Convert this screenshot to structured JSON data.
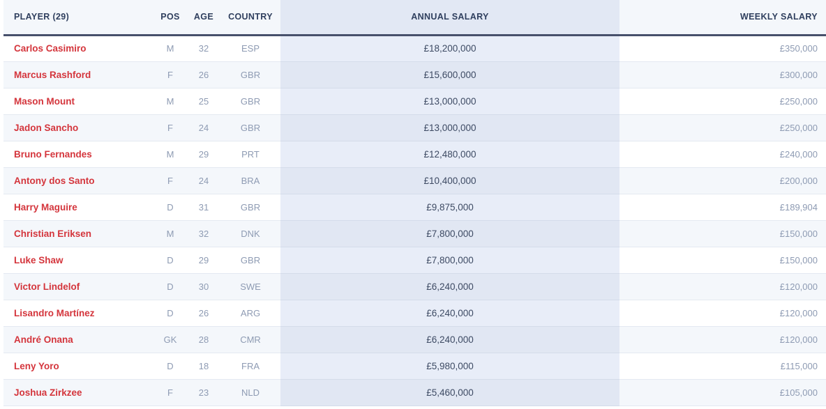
{
  "table": {
    "columns": [
      {
        "key": "player",
        "label": "PLAYER (29)",
        "align": "left"
      },
      {
        "key": "pos",
        "label": "POS",
        "align": "center"
      },
      {
        "key": "age",
        "label": "AGE",
        "align": "center"
      },
      {
        "key": "country",
        "label": "COUNTRY",
        "align": "center"
      },
      {
        "key": "annual",
        "label": "ANNUAL SALARY",
        "align": "center"
      },
      {
        "key": "weekly",
        "label": "WEEKLY SALARY",
        "align": "right"
      }
    ],
    "rows": [
      {
        "player": "Carlos Casimiro",
        "pos": "M",
        "age": "32",
        "country": "ESP",
        "annual": "£18,200,000",
        "weekly": "£350,000"
      },
      {
        "player": "Marcus Rashford",
        "pos": "F",
        "age": "26",
        "country": "GBR",
        "annual": "£15,600,000",
        "weekly": "£300,000"
      },
      {
        "player": "Mason Mount",
        "pos": "M",
        "age": "25",
        "country": "GBR",
        "annual": "£13,000,000",
        "weekly": "£250,000"
      },
      {
        "player": "Jadon Sancho",
        "pos": "F",
        "age": "24",
        "country": "GBR",
        "annual": "£13,000,000",
        "weekly": "£250,000"
      },
      {
        "player": "Bruno Fernandes",
        "pos": "M",
        "age": "29",
        "country": "PRT",
        "annual": "£12,480,000",
        "weekly": "£240,000"
      },
      {
        "player": "Antony dos Santo",
        "pos": "F",
        "age": "24",
        "country": "BRA",
        "annual": "£10,400,000",
        "weekly": "£200,000"
      },
      {
        "player": "Harry Maguire",
        "pos": "D",
        "age": "31",
        "country": "GBR",
        "annual": "£9,875,000",
        "weekly": "£189,904"
      },
      {
        "player": "Christian Eriksen",
        "pos": "M",
        "age": "32",
        "country": "DNK",
        "annual": "£7,800,000",
        "weekly": "£150,000"
      },
      {
        "player": "Luke Shaw",
        "pos": "D",
        "age": "29",
        "country": "GBR",
        "annual": "£7,800,000",
        "weekly": "£150,000"
      },
      {
        "player": "Victor Lindelof",
        "pos": "D",
        "age": "30",
        "country": "SWE",
        "annual": "£6,240,000",
        "weekly": "£120,000"
      },
      {
        "player": "Lisandro Martínez",
        "pos": "D",
        "age": "26",
        "country": "ARG",
        "annual": "£6,240,000",
        "weekly": "£120,000"
      },
      {
        "player": "André Onana",
        "pos": "GK",
        "age": "28",
        "country": "CMR",
        "annual": "£6,240,000",
        "weekly": "£120,000"
      },
      {
        "player": "Leny Yoro",
        "pos": "D",
        "age": "18",
        "country": "FRA",
        "annual": "£5,980,000",
        "weekly": "£115,000"
      },
      {
        "player": "Joshua Zirkzee",
        "pos": "F",
        "age": "23",
        "country": "NLD",
        "annual": "£5,460,000",
        "weekly": "£105,000"
      }
    ]
  },
  "colors": {
    "player_name": "#d4353c",
    "header_text": "#2f3f5e",
    "header_bg": "#f4f7fb",
    "annual_header_bg": "#e2e8f4",
    "annual_cell_bg": "#e8edf8",
    "annual_cell_bg_alt": "#e1e7f3",
    "row_alt_bg": "#f4f7fb",
    "muted_text": "#8e9bb3",
    "value_text": "#3d4a63",
    "header_rule": "#47506b"
  }
}
